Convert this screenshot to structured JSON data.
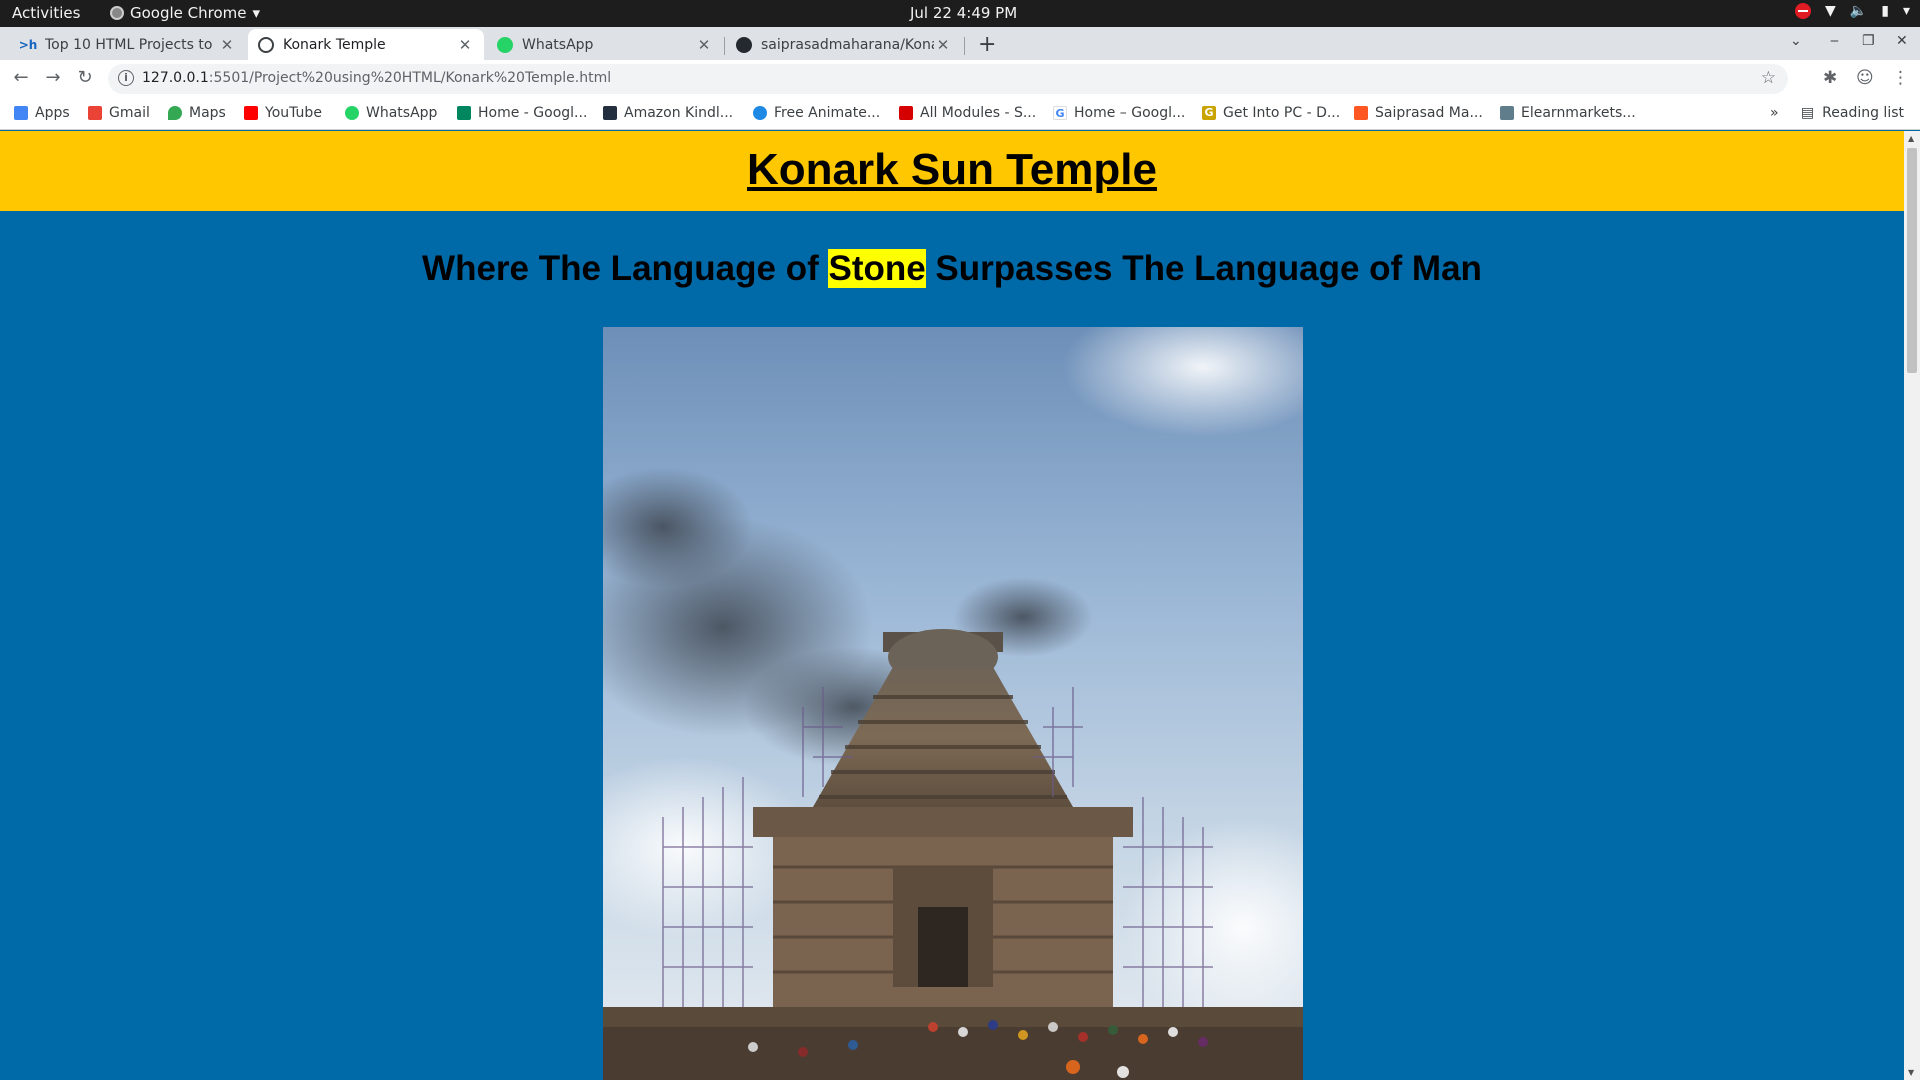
{
  "system": {
    "activities": "Activities",
    "app_name": "Google Chrome",
    "clock": "Jul 22   4:49 PM"
  },
  "tabs": [
    {
      "title": "Top 10 HTML Projects to E",
      "favicon": ">h"
    },
    {
      "title": "Konark Temple",
      "favicon": "globe"
    },
    {
      "title": "WhatsApp",
      "favicon": "whatsapp"
    },
    {
      "title": "saiprasadmaharana/Kona",
      "favicon": "github"
    }
  ],
  "omnibox": {
    "host": "127.0.0.1",
    "path": ":5501/Project%20using%20HTML/Konark%20Temple.html"
  },
  "bookmarks": [
    {
      "label": "Apps",
      "color": "#4285f4"
    },
    {
      "label": "Gmail",
      "color": "#ea4335"
    },
    {
      "label": "Maps",
      "color": "#34a853"
    },
    {
      "label": "YouTube",
      "color": "#ff0000"
    },
    {
      "label": "WhatsApp",
      "color": "#25d366"
    },
    {
      "label": "Home - Googl...",
      "color": "#01875f"
    },
    {
      "label": "Amazon Kindl...",
      "color": "#232f3e"
    },
    {
      "label": "Free Animate...",
      "color": "#1e88e5"
    },
    {
      "label": "All Modules - S...",
      "color": "#d50000"
    },
    {
      "label": "Home – Googl...",
      "color": "#4285f4"
    },
    {
      "label": "Get Into PC - D...",
      "color": "#c9a400"
    },
    {
      "label": "Saiprasad Ma...",
      "color": "#ff5722"
    },
    {
      "label": "Elearnmarkets...",
      "color": "#607d8b"
    }
  ],
  "reading_list": "Reading list",
  "page": {
    "title": "Konark Sun Temple",
    "tagline_before": "Where The Language of ",
    "tagline_highlight": "Stone",
    "tagline_after": " Surpasses The Language of Man",
    "colors": {
      "header": "#ffc700",
      "background": "#0069a8",
      "highlight": "#ffff00"
    }
  }
}
